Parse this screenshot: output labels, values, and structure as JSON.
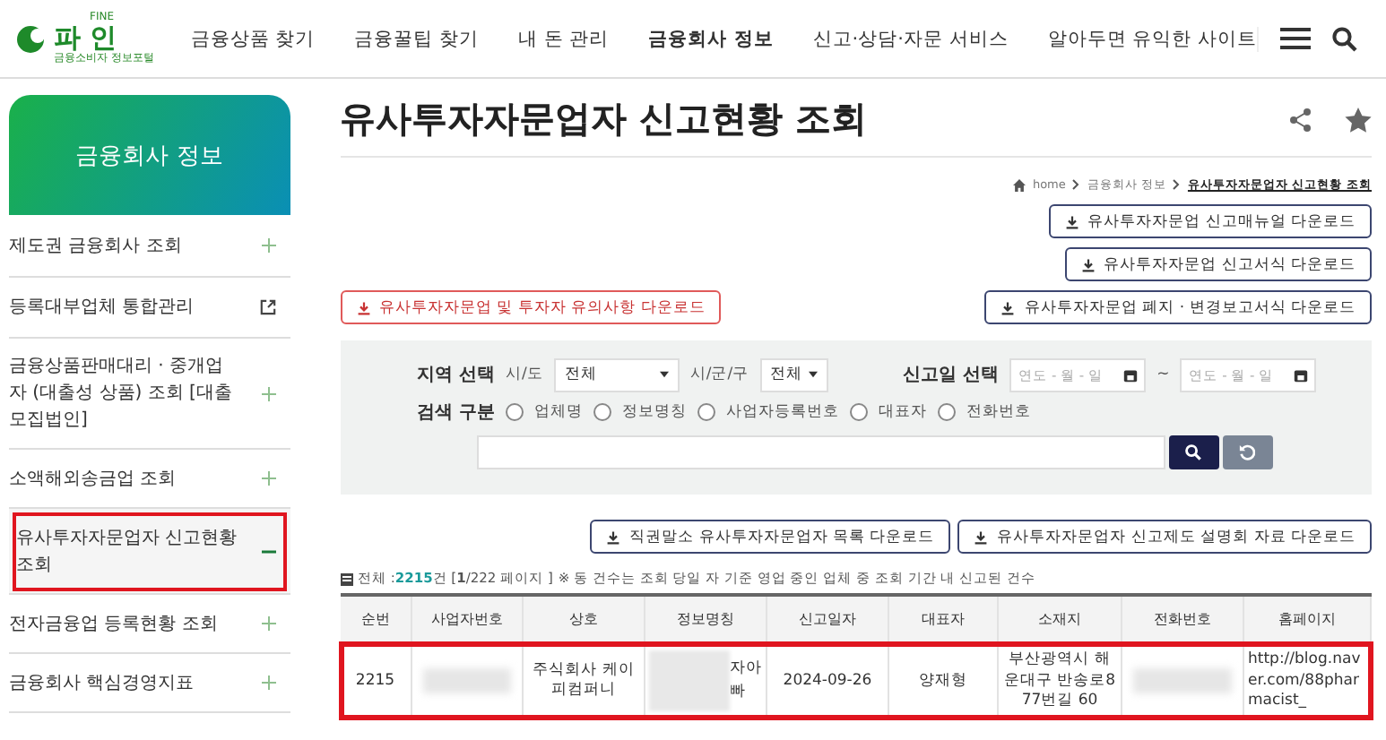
{
  "header": {
    "logo": {
      "small": "FINE",
      "name": "파 인",
      "tagline": "금융소비자 정보포털"
    },
    "nav": [
      {
        "label": "금융상품 찾기",
        "selected": false
      },
      {
        "label": "금융꿀팁 찾기",
        "selected": false
      },
      {
        "label": "내 돈 관리",
        "selected": false
      },
      {
        "label": "금융회사 정보",
        "selected": true
      },
      {
        "label": "신고·상담·자문 서비스",
        "selected": false
      },
      {
        "label": "알아두면 유익한 사이트",
        "selected": false
      }
    ]
  },
  "sidebar": {
    "title": "금융회사 정보",
    "items": [
      {
        "label": "제도권 금융회사 조회",
        "kind": "expand",
        "selected": false,
        "highlighted": false
      },
      {
        "label": "등록대부업체 통합관리",
        "kind": "link",
        "selected": false,
        "highlighted": false
      },
      {
        "label": "금융상품판매대리 · 중개업자 (대출성 상품) 조회 [대출모집법인]",
        "kind": "expand",
        "selected": false,
        "highlighted": false
      },
      {
        "label": "소액해외송금업 조회",
        "kind": "expand",
        "selected": false,
        "highlighted": false
      },
      {
        "label": "유사투자자문업자 신고현황 조회",
        "kind": "expand",
        "selected": true,
        "highlighted": true
      },
      {
        "label": "전자금융업 등록현황 조회",
        "kind": "expand",
        "selected": false,
        "highlighted": false
      },
      {
        "label": "금융회사 핵심경영지표",
        "kind": "expand",
        "selected": false,
        "highlighted": false
      }
    ]
  },
  "page": {
    "title": "유사투자자문업자 신고현황 조회",
    "breadcrumb": [
      "home",
      "금융회사 정보",
      "유사투자자문업자 신고현황 조회"
    ],
    "downloads_right": [
      "유사투자자문업 신고매뉴얼 다운로드",
      "유사투자자문업 신고서식 다운로드",
      "유사투자자문업 폐지 · 변경보고서식 다운로드"
    ],
    "download_notice": "유사투자자문업 및 투자자 유의사항 다운로드"
  },
  "search": {
    "region_label": "지역 선택",
    "sido_label": "시/도",
    "sido_value": "전체",
    "sigungu_label": "시/군/구",
    "sigungu_value": "전체",
    "date_label": "신고일 선택",
    "date_from": {
      "placeholder": "연도 - 월 - 일"
    },
    "date_sep": "~",
    "date_to": {
      "placeholder": "연도 - 월 - 일"
    },
    "type_label": "검색 구분",
    "types": [
      {
        "label": "업체명",
        "selected": false
      },
      {
        "label": "정보명칭",
        "selected": false
      },
      {
        "label": "사업자등록번호",
        "selected": false
      },
      {
        "label": "대표자",
        "selected": false
      },
      {
        "label": "전화번호",
        "selected": false
      }
    ]
  },
  "list_downloads": [
    "직권말소 유사투자자문업자 목록 다운로드",
    "유사투자자문업자 신고제도 설명회 자료 다운로드"
  ],
  "summary": {
    "prefix": "전체 :",
    "total": "2215",
    "unit": "건 [",
    "page": "1",
    "pages": "/222 페이지 ]",
    "note": "※ 동 건수는 조회 당일 자 기준 영업 중인 업체 중 조회 기간 내 신고된 건수"
  },
  "table": {
    "columns": [
      "순번",
      "사업자번호",
      "상호",
      "정보명칭",
      "신고일자",
      "대표자",
      "소재지",
      "전화번호",
      "홈페이지"
    ],
    "rows": [
      {
        "highlighted": true,
        "cells": [
          {
            "kind": "text",
            "text": "2215"
          },
          {
            "kind": "blurred"
          },
          {
            "kind": "text",
            "text": "주식회사 케이피컴퍼니"
          },
          {
            "kind": "partial",
            "lines": [
              "자아",
              "빠"
            ]
          },
          {
            "kind": "text",
            "text": "2024-09-26"
          },
          {
            "kind": "text",
            "text": "양재형"
          },
          {
            "kind": "text",
            "text": "부산광역시 해운대구 반송로877번길 60"
          },
          {
            "kind": "blurred"
          },
          {
            "kind": "text",
            "text": "http://blog.naver.com/88pharmacist_"
          }
        ]
      }
    ]
  }
}
